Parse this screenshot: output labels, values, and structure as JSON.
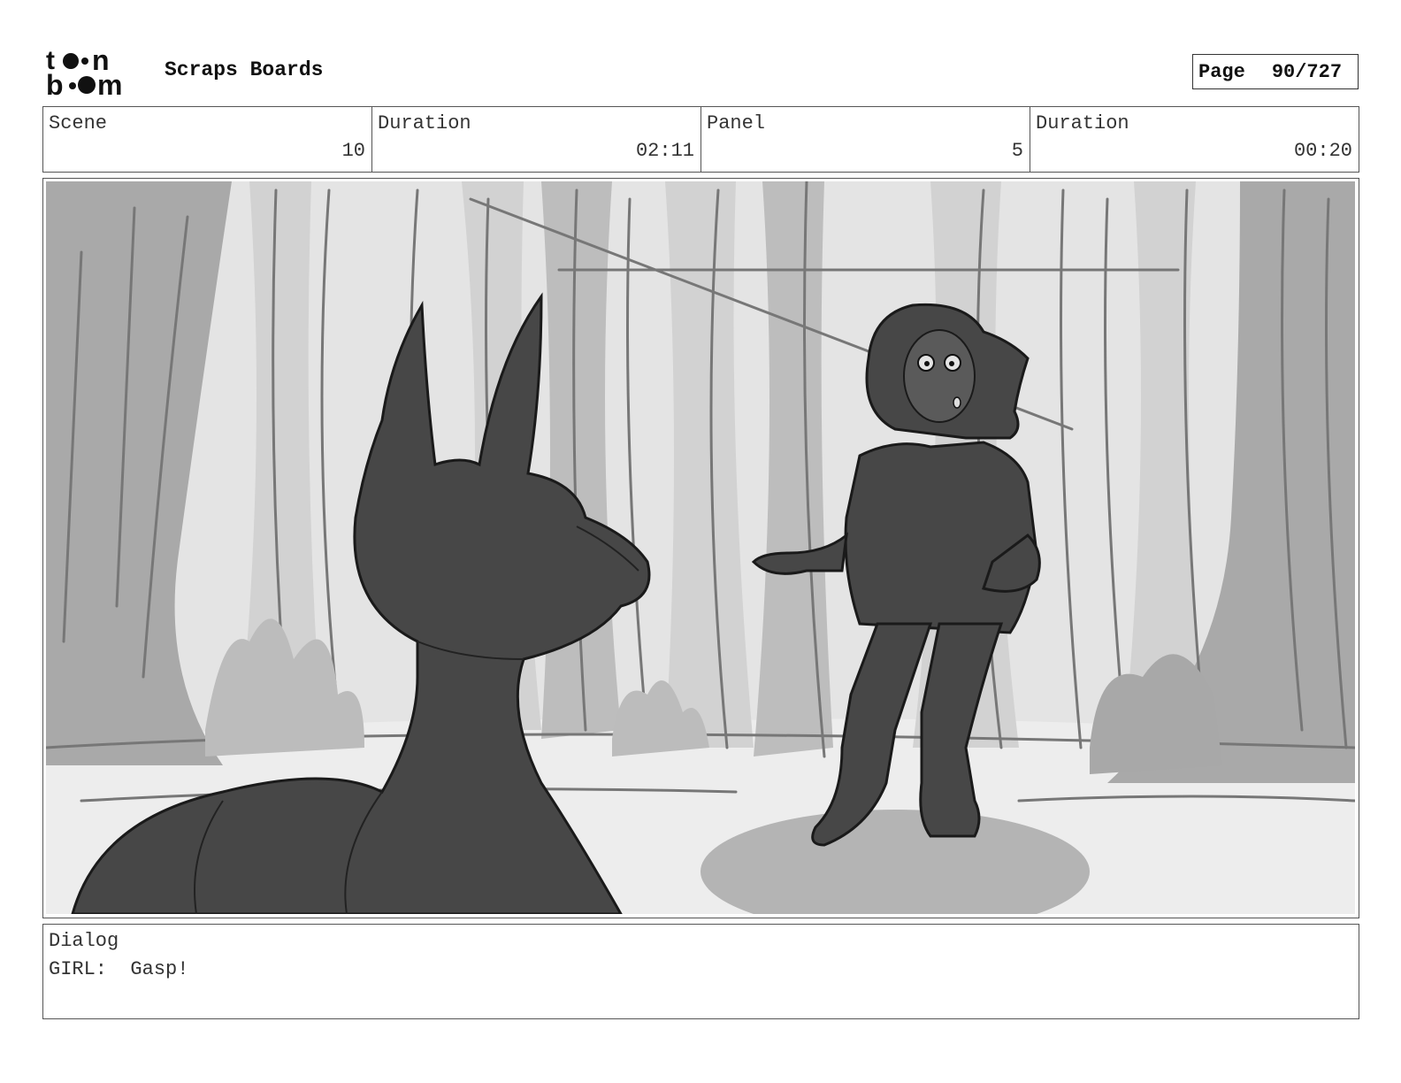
{
  "header": {
    "brand": "toon boom",
    "title": "Scraps Boards",
    "page_label": "Page",
    "page_value": "90/727"
  },
  "info": {
    "scene_label": "Scene",
    "scene_value": "10",
    "scene_duration_label": "Duration",
    "scene_duration_value": "02:11",
    "panel_label": "Panel",
    "panel_value": "5",
    "panel_duration_label": "Duration",
    "panel_duration_value": "00:20"
  },
  "dialog": {
    "label": "Dialog",
    "text": "GIRL:  Gasp!"
  }
}
